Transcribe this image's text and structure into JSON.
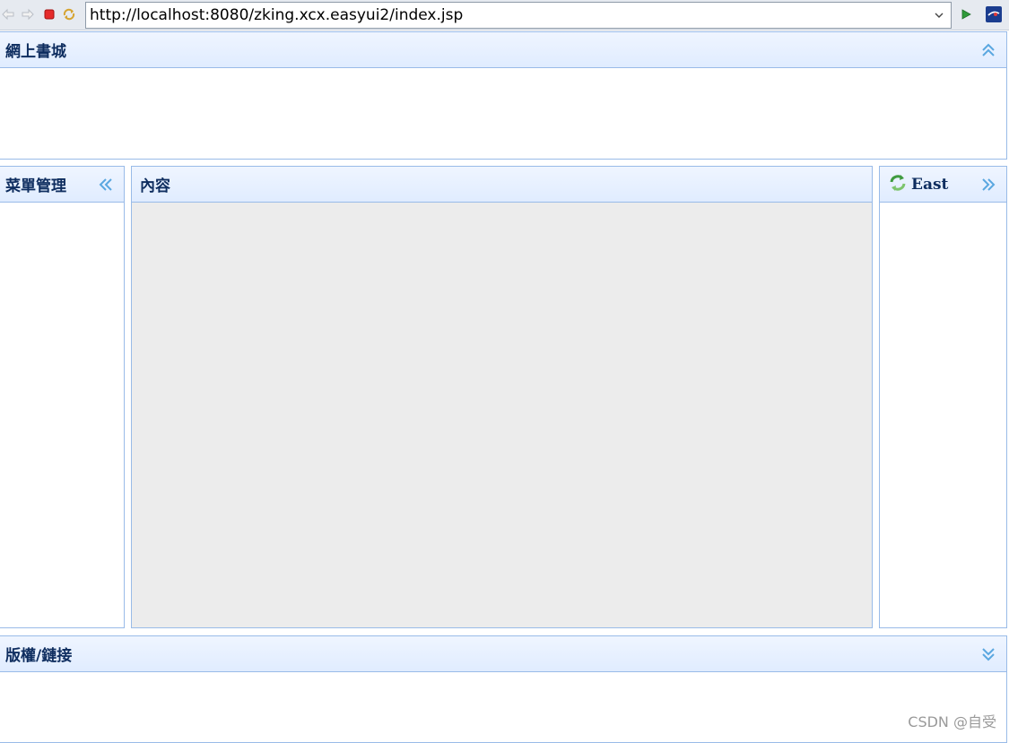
{
  "browser": {
    "url": "http://localhost:8080/zking.xcx.easyui2/index.jsp",
    "icons": [
      "back-arrow-icon",
      "forward-arrow-icon",
      "stop-icon",
      "refresh-icon",
      "dropdown-chevron-icon",
      "go-play-icon",
      "browser-logo-icon"
    ]
  },
  "layout": {
    "north": {
      "title": "網上書城",
      "tool": "collapse-up-icon"
    },
    "west": {
      "title": "菜單管理",
      "tool": "collapse-left-icon"
    },
    "center": {
      "title": "內容"
    },
    "east": {
      "title": "East",
      "icon": "refresh-cycle-icon",
      "tool": "collapse-right-icon"
    },
    "south": {
      "title": "版權/鏈接",
      "tool": "collapse-down-icon"
    }
  },
  "colors": {
    "panel_border": "#99bbe8",
    "header_top": "#eff5ff",
    "header_bottom": "#e0ecff",
    "title_text": "#0e2d5f",
    "tool_icon": "#5aa7e0",
    "center_body": "#ececec"
  },
  "watermark": "CSDN @自受"
}
